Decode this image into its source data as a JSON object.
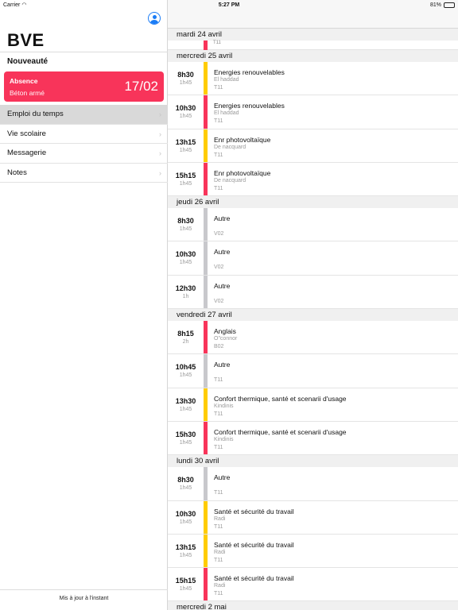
{
  "status_bar": {
    "carrier": "Carrier",
    "time": "5:27 PM",
    "battery": "81%",
    "battery_level": 0.81
  },
  "colors": {
    "red": "#f8345a",
    "yellow": "#ffcc00",
    "gray": "#c8c8cc",
    "accent": "#1a7cf6"
  },
  "master": {
    "app_title": "BVE",
    "profile_icon": "person-circle-icon",
    "section": "Nouveauté",
    "absence_card": {
      "title": "Absence",
      "subject": "Béton armé",
      "date": "17/02"
    },
    "menu": [
      {
        "label": "Emploi du temps",
        "selected": true
      },
      {
        "label": "Vie scolaire",
        "selected": false
      },
      {
        "label": "Messagerie",
        "selected": false
      },
      {
        "label": "Notes",
        "selected": false
      }
    ],
    "footer": "Mis à jour à l'instant"
  },
  "schedule": {
    "top_day": {
      "label": "mardi 24 avril",
      "room": "T11",
      "color": "red"
    },
    "days": [
      {
        "label": "mercredi 25 avril",
        "events": [
          {
            "time": "8h30",
            "duration": "1h45",
            "title": "Energies renouvelables",
            "teacher": "El haddad",
            "room": "T11",
            "color": "yellow"
          },
          {
            "time": "10h30",
            "duration": "1h45",
            "title": "Energies renouvelables",
            "teacher": "El haddad",
            "room": "T11",
            "color": "red"
          },
          {
            "time": "13h15",
            "duration": "1h45",
            "title": "Enr photovoltaïque",
            "teacher": "De nacquard",
            "room": "T11",
            "color": "yellow"
          },
          {
            "time": "15h15",
            "duration": "1h45",
            "title": "Enr photovoltaïque",
            "teacher": "De nacquard",
            "room": "T11",
            "color": "red"
          }
        ]
      },
      {
        "label": "jeudi 26 avril",
        "events": [
          {
            "time": "8h30",
            "duration": "1h45",
            "title": "Autre",
            "teacher": "",
            "room": "V02",
            "color": "gray"
          },
          {
            "time": "10h30",
            "duration": "1h45",
            "title": "Autre",
            "teacher": "",
            "room": "V02",
            "color": "gray"
          },
          {
            "time": "12h30",
            "duration": "1h",
            "title": "Autre",
            "teacher": "",
            "room": "V02",
            "color": "gray"
          }
        ]
      },
      {
        "label": "vendredi 27 avril",
        "events": [
          {
            "time": "8h15",
            "duration": "2h",
            "title": "Anglais",
            "teacher": "O\"connor",
            "room": "B02",
            "color": "red"
          },
          {
            "time": "10h45",
            "duration": "1h45",
            "title": "Autre",
            "teacher": "",
            "room": "T11",
            "color": "gray"
          },
          {
            "time": "13h30",
            "duration": "1h45",
            "title": "Confort thermique, santé et scenarii d'usage",
            "teacher": "Kindinis",
            "room": "T11",
            "color": "yellow"
          },
          {
            "time": "15h30",
            "duration": "1h45",
            "title": "Confort thermique, santé et scenarii d'usage",
            "teacher": "Kindinis",
            "room": "T11",
            "color": "red"
          }
        ]
      },
      {
        "label": "lundi 30 avril",
        "events": [
          {
            "time": "8h30",
            "duration": "1h45",
            "title": "Autre",
            "teacher": "",
            "room": "T11",
            "color": "gray"
          },
          {
            "time": "10h30",
            "duration": "1h45",
            "title": "Santé et sécurité du travail",
            "teacher": "Radi",
            "room": "T11",
            "color": "yellow"
          },
          {
            "time": "13h15",
            "duration": "1h45",
            "title": "Santé et sécurité du travail",
            "teacher": "Radi",
            "room": "T11",
            "color": "yellow"
          },
          {
            "time": "15h15",
            "duration": "1h45",
            "title": "Santé et sécurité du travail",
            "teacher": "Radi",
            "room": "T11",
            "color": "red"
          }
        ]
      },
      {
        "label": "mercredi 2 mai",
        "events": []
      }
    ]
  }
}
